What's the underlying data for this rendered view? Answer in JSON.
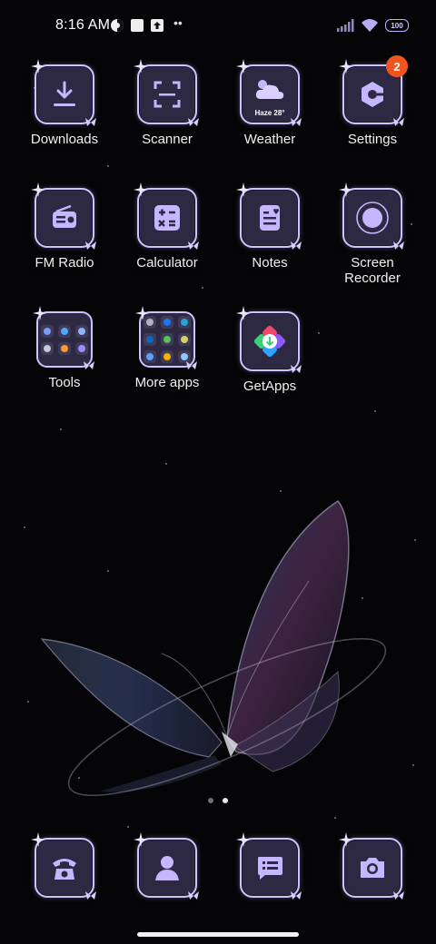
{
  "status_bar": {
    "time": "8:16 AM",
    "notification_icons": [
      "data-saver-icon",
      "square-notification-icon",
      "upload-arrow-icon"
    ],
    "more_indicator": "••",
    "battery_level": "100"
  },
  "apps": [
    {
      "label": "Downloads",
      "icon": "download-icon"
    },
    {
      "label": "Scanner",
      "icon": "scanner-icon"
    },
    {
      "label": "Weather",
      "icon": "weather-cloud-icon",
      "widget_text": "Haze 28°"
    },
    {
      "label": "Settings",
      "icon": "settings-icon",
      "badge": "2"
    },
    {
      "label": "FM Radio",
      "icon": "radio-icon"
    },
    {
      "label": "Calculator",
      "icon": "calculator-icon"
    },
    {
      "label": "Notes",
      "icon": "notes-icon"
    },
    {
      "label": "Screen Recorder",
      "icon": "screen-recorder-icon"
    },
    {
      "label": "Tools",
      "icon": "folder-icon"
    },
    {
      "label": "More apps",
      "icon": "folder-icon"
    },
    {
      "label": "GetApps",
      "icon": "getapps-icon"
    }
  ],
  "dock": [
    {
      "icon": "phone-icon"
    },
    {
      "icon": "contacts-icon"
    },
    {
      "icon": "messages-icon"
    },
    {
      "icon": "camera-icon"
    }
  ],
  "page_indicator": {
    "pages": 2,
    "active_page": 2
  },
  "colors": {
    "background": "#050507",
    "icon_fill": "#2d2942",
    "icon_border": "#cdc3ff",
    "glyph": "#c5b7ff",
    "badge": "#f1541e"
  }
}
